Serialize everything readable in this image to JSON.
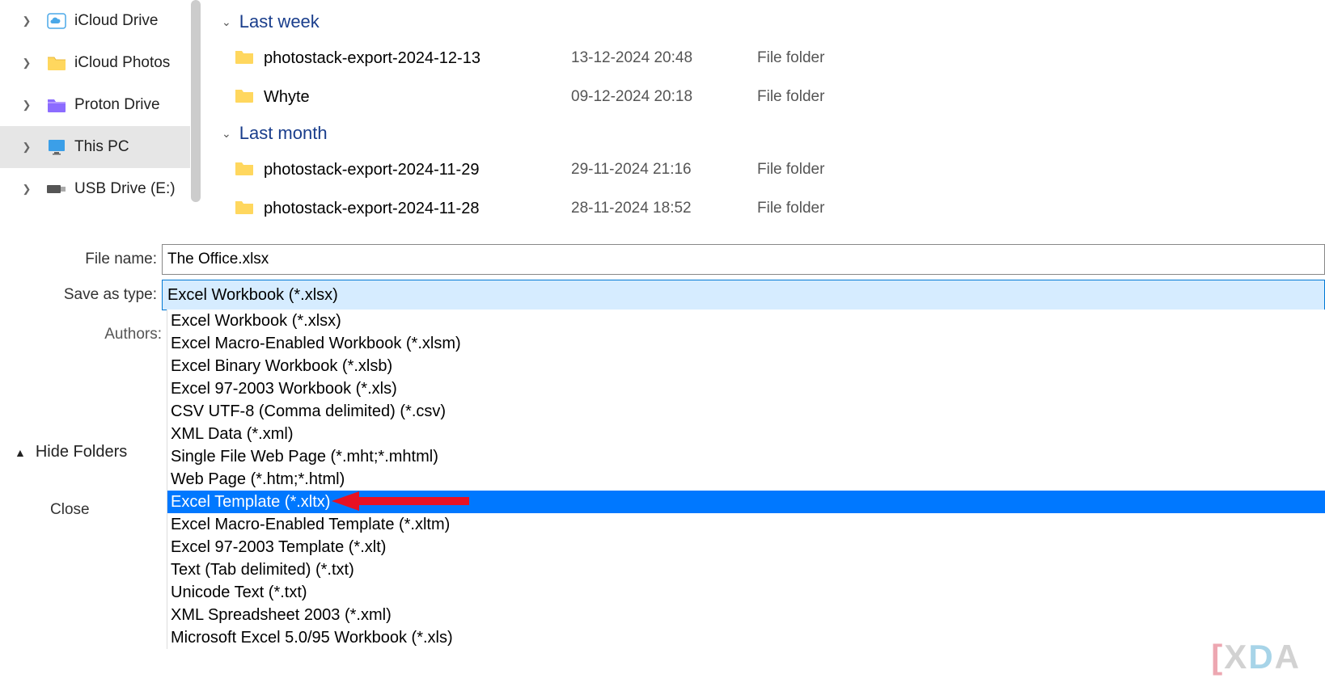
{
  "sidebar": {
    "items": [
      {
        "label": "iCloud Drive",
        "icon": "icloud",
        "selected": false
      },
      {
        "label": "iCloud Photos",
        "icon": "folder-yellow",
        "selected": false
      },
      {
        "label": "Proton Drive",
        "icon": "proton",
        "selected": false
      },
      {
        "label": "This PC",
        "icon": "monitor",
        "selected": true
      },
      {
        "label": "USB Drive (E:)",
        "icon": "usb",
        "selected": false
      }
    ]
  },
  "groups": [
    {
      "title": "Last week",
      "rows": [
        {
          "name": "photostack-export-2024-12-13",
          "date": "13-12-2024 20:48",
          "type": "File folder"
        },
        {
          "name": "Whyte",
          "date": "09-12-2024 20:18",
          "type": "File folder"
        }
      ]
    },
    {
      "title": "Last month",
      "rows": [
        {
          "name": "photostack-export-2024-11-29",
          "date": "29-11-2024 21:16",
          "type": "File folder"
        },
        {
          "name": "photostack-export-2024-11-28",
          "date": "28-11-2024 18:52",
          "type": "File folder"
        }
      ]
    }
  ],
  "form": {
    "filename_label": "File name:",
    "filename_value": "The Office.xlsx",
    "saveas_label": "Save as type:",
    "saveas_value": "Excel Workbook (*.xlsx)",
    "authors_label": "Authors:"
  },
  "dropdown": {
    "highlighted_index": 8,
    "items": [
      "Excel Workbook (*.xlsx)",
      "Excel Macro-Enabled Workbook (*.xlsm)",
      "Excel Binary Workbook (*.xlsb)",
      "Excel 97-2003 Workbook (*.xls)",
      "CSV UTF-8 (Comma delimited) (*.csv)",
      "XML Data (*.xml)",
      "Single File Web Page (*.mht;*.mhtml)",
      "Web Page (*.htm;*.html)",
      "Excel Template (*.xltx)",
      "Excel Macro-Enabled Template (*.xltm)",
      "Excel 97-2003 Template (*.xlt)",
      "Text (Tab delimited) (*.txt)",
      "Unicode Text (*.txt)",
      "XML Spreadsheet 2003 (*.xml)",
      "Microsoft Excel 5.0/95 Workbook (*.xls)"
    ]
  },
  "hide_folders_label": "Hide Folders",
  "close_label": "Close",
  "watermark": {
    "prefix": "[",
    "x": "X",
    "d": "D",
    "a": "A"
  }
}
